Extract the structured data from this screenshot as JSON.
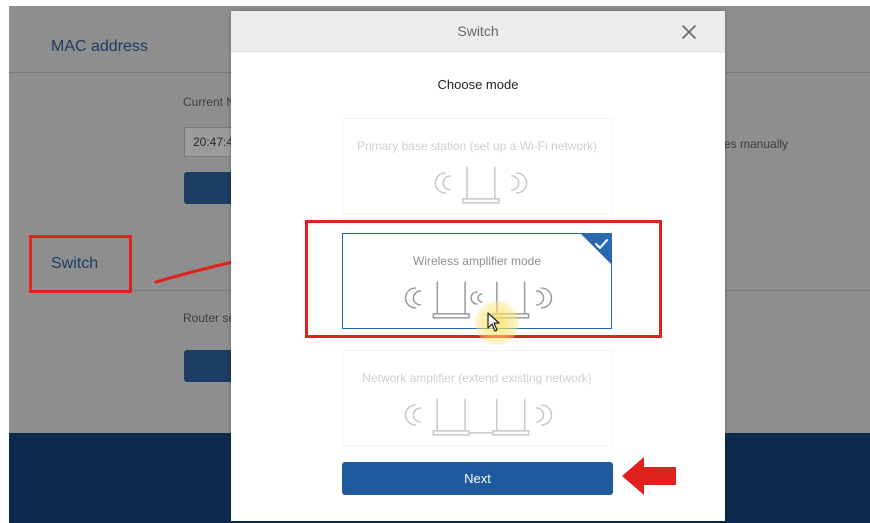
{
  "background": {
    "mac_section_title": "MAC address",
    "current_label": "Current N",
    "mac_value": "20:47:4",
    "manual_text": "es manually",
    "switch_section_title": "Switch",
    "router_label": "Router se"
  },
  "modal": {
    "title": "Switch",
    "close_icon": "close-icon",
    "choose_label": "Choose mode",
    "modes": [
      {
        "label": "Primary base station (set up a Wi-Fi network)",
        "state": "disabled"
      },
      {
        "label": "Wireless amplifier mode",
        "state": "selected"
      },
      {
        "label": "Network amplifier (extend existing network)",
        "state": "disabled"
      }
    ],
    "next_label": "Next"
  },
  "colors": {
    "accent": "#1f5a9e",
    "annotation_red": "#e0211e",
    "overlay_gray": "#8e8e8e",
    "footer_navy": "#0e2a4f"
  }
}
